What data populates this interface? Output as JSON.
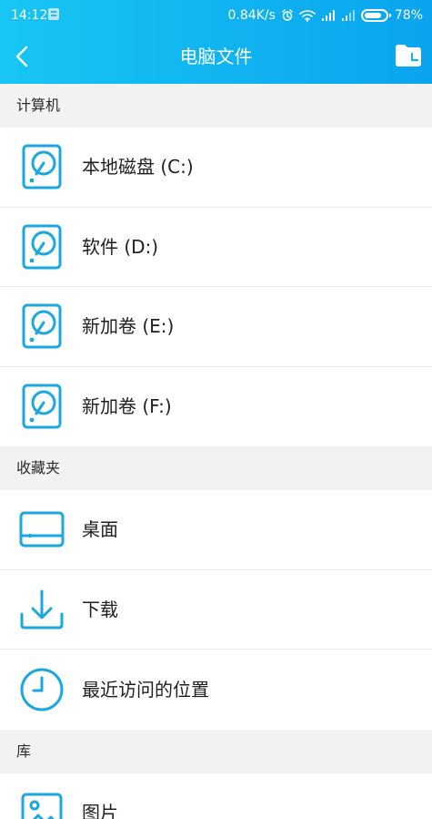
{
  "status": {
    "time": "14:12",
    "speed": "0.84K/s",
    "battery": "78%",
    "battery_level": 0.78
  },
  "nav": {
    "title": "电脑文件"
  },
  "sections": {
    "computer": {
      "title": "计算机",
      "items": [
        {
          "label": "本地磁盘 (C:)",
          "icon": "hard-drive-icon"
        },
        {
          "label": "软件 (D:)",
          "icon": "hard-drive-icon"
        },
        {
          "label": "新加卷 (E:)",
          "icon": "hard-drive-icon"
        },
        {
          "label": "新加卷 (F:)",
          "icon": "hard-drive-icon"
        }
      ]
    },
    "favorites": {
      "title": "收藏夹",
      "items": [
        {
          "label": "桌面",
          "icon": "desktop-icon"
        },
        {
          "label": "下载",
          "icon": "download-icon"
        },
        {
          "label": "最近访问的位置",
          "icon": "clock-icon"
        }
      ]
    },
    "library": {
      "title": "库",
      "items": [
        {
          "label": "图片",
          "icon": "image-icon"
        }
      ]
    }
  },
  "colors": {
    "header_start": "#17c6f4",
    "header_end": "#0aa4ee",
    "icon_blue": "#1ba7e0",
    "section_bg": "#f2f2f2"
  }
}
